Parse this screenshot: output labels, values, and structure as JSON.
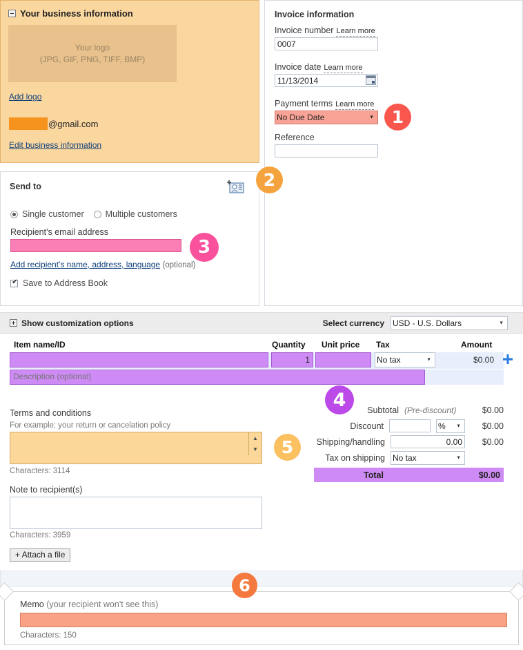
{
  "business": {
    "heading": "Your business information",
    "collapse_icon": "minus-box-icon",
    "logo_placeholder_line1": "Your logo",
    "logo_placeholder_line2": "(JPG, GIF, PNG, TIFF, BMP)",
    "add_logo_link": "Add logo",
    "email_domain": "@gmail.com",
    "edit_link": "Edit business information",
    "bg_color": "#fbd7a0"
  },
  "invoice": {
    "heading": "Invoice information",
    "number_label": "Invoice number",
    "number_learn_more": "Learn more",
    "number_value": "0007",
    "date_label": "Invoice date",
    "date_learn_more": "Learn more",
    "date_value": "11/13/2014",
    "calendar_icon": "calendar-icon",
    "terms_label": "Payment terms",
    "terms_learn_more": "Learn more",
    "terms_value": "No Due Date",
    "terms_highlight_color": "#f8a396",
    "reference_label": "Reference",
    "reference_value": ""
  },
  "send_to": {
    "heading": "Send to",
    "address_book_icon": "address-book-add-icon",
    "radio_single": "Single customer",
    "radio_multiple": "Multiple customers",
    "selected_radio": "Single customer",
    "email_label": "Recipient's email address",
    "email_value": "",
    "email_highlight_color": "#fb7fb5",
    "add_recipient_link": "Add recipient's name, address, language",
    "add_recipient_optional": "(optional)",
    "save_address_book": "Save to Address Book",
    "save_address_book_checked": true
  },
  "customization": {
    "show_options": "Show customization options",
    "expand_icon": "plus-box-icon",
    "currency_label": "Select currency",
    "currency_value": "USD - U.S. Dollars"
  },
  "items": {
    "columns": [
      "Item name/ID",
      "Quantity",
      "Unit price",
      "Tax",
      "Amount"
    ],
    "row": {
      "item_name": "",
      "quantity": "1",
      "unit_price": "",
      "tax": "No tax",
      "amount": "$0.00",
      "description_placeholder": "Description (optional)"
    },
    "add_row_icon": "plus-icon",
    "highlight_color": "#cf8bf5"
  },
  "terms": {
    "label": "Terms and conditions",
    "hint": "For example: your return or cancelation policy",
    "value": "",
    "characters": "Characters: 3114",
    "highlight_color": "#fbd79a",
    "scroll_up_icon": "triangle-up-icon",
    "scroll_down_icon": "triangle-down-icon"
  },
  "note": {
    "label": "Note to recipient(s)",
    "value": "",
    "characters": "Characters: 3959"
  },
  "attach": {
    "label": "+ Attach a file"
  },
  "totals": {
    "subtotal_label": "Subtotal",
    "subtotal_note": "(Pre-discount)",
    "subtotal_value": "$0.00",
    "discount_label": "Discount",
    "discount_value": "",
    "discount_unit": "%",
    "discount_amount": "$0.00",
    "shipping_label": "Shipping/handling",
    "shipping_value": "0.00",
    "shipping_amount": "$0.00",
    "tax_shipping_label": "Tax on shipping",
    "tax_shipping_value": "No tax",
    "total_label": "Total",
    "total_value": "$0.00",
    "total_highlight_color": "#cf8bf5"
  },
  "memo": {
    "label": "Memo",
    "sub_label": "(your recipient won't see this)",
    "value": "",
    "characters": "Characters: 150",
    "highlight_color": "#f9a285"
  },
  "badges": [
    {
      "n": "1",
      "color": "#f9574d"
    },
    {
      "n": "2",
      "color": "#f5a33f"
    },
    {
      "n": "3",
      "color": "#f9519c"
    },
    {
      "n": "4",
      "color": "#bb4ae8"
    },
    {
      "n": "5",
      "color": "#fbc060"
    },
    {
      "n": "6",
      "color": "#f4793e"
    }
  ]
}
